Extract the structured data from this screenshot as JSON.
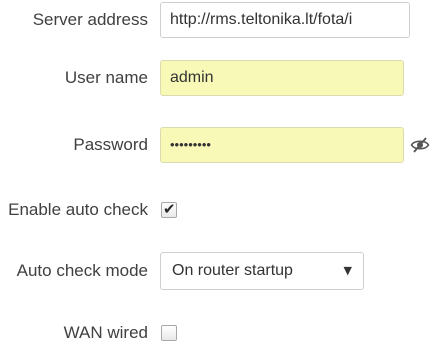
{
  "form": {
    "server_address": {
      "label": "Server address",
      "value": "http://rms.teltonika.lt/fota/i"
    },
    "user_name": {
      "label": "User name",
      "value": "admin"
    },
    "password": {
      "label": "Password",
      "value": "•••••••••",
      "toggle_icon": "eye-slash-icon"
    },
    "enable_auto_check": {
      "label": "Enable auto check",
      "checked": true
    },
    "auto_check_mode": {
      "label": "Auto check mode",
      "selected": "On router startup",
      "arrow": "▼"
    },
    "wan_wired": {
      "label": "WAN wired",
      "checked": false
    }
  },
  "colors": {
    "autofill_background": "#f8f9b7",
    "label_text": "#404040",
    "border": "#cfcfcf"
  }
}
